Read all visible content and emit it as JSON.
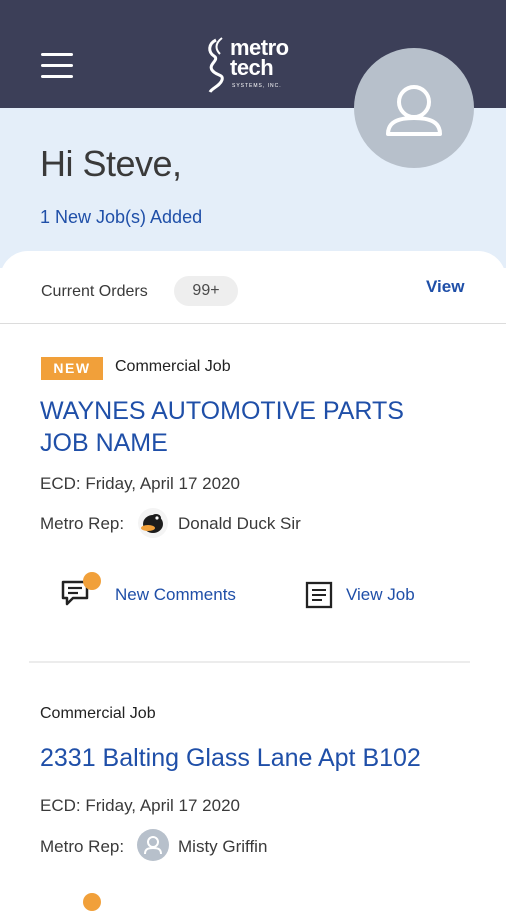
{
  "header": {
    "menu_icon": "hamburger-menu-icon",
    "logo_line1": "metro",
    "logo_line2": "tech",
    "logo_sub": "SYSTEMS, INC.",
    "profile_icon": "user-profile-icon"
  },
  "hero": {
    "greeting": "Hi Steve,",
    "new_jobs": "1 New Job(s) Added"
  },
  "orders": {
    "label": "Current Orders",
    "count": "99+",
    "view_label": "View"
  },
  "jobs": [
    {
      "tag": "NEW",
      "type": "Commercial Job",
      "title_line1": "WAYNES AUTOMOTIVE PARTS",
      "title_line2": "JOB NAME",
      "ecd": "ECD: Friday, April 17 2020",
      "rep_label": "Metro Rep:",
      "rep_name": "Donald Duck Sir",
      "comments_label": "New Comments",
      "view_job_label": "View Job"
    },
    {
      "type": "Commercial Job",
      "title_line1": "2331 Balting Glass Lane Apt B102",
      "ecd": "ECD: Friday, April 17 2020",
      "rep_label": "Metro Rep:",
      "rep_name": "Misty Griffin"
    }
  ],
  "colors": {
    "header_bg": "#3c3f58",
    "hero_bg": "#e4eef9",
    "accent_blue": "#1f4fa8",
    "badge_orange": "#f1a03a"
  }
}
